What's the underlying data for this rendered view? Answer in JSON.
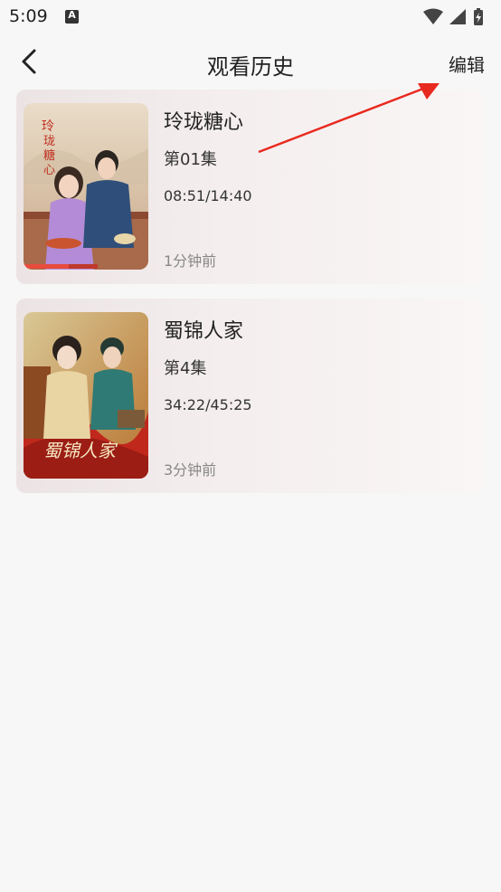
{
  "status_bar": {
    "time": "5:09",
    "notification_badge": "A"
  },
  "header": {
    "title": "观看历史",
    "edit_label": "编辑"
  },
  "history": [
    {
      "title": "玲珑糖心",
      "episode": "第01集",
      "progress": "08:51/14:40",
      "progress_fraction": 0.6,
      "time_ago": "1分钟前",
      "poster_text": "玲珑糖心"
    },
    {
      "title": "蜀锦人家",
      "episode": "第4集",
      "progress": "34:22/45:25",
      "progress_fraction": 0.76,
      "time_ago": "3分钟前",
      "poster_text": "蜀锦人家"
    }
  ],
  "colors": {
    "annotation_arrow": "#e8291f",
    "text_muted": "#888888"
  },
  "icons": [
    "wifi-icon",
    "signal-icon",
    "battery-icon",
    "back-arrow-icon"
  ]
}
